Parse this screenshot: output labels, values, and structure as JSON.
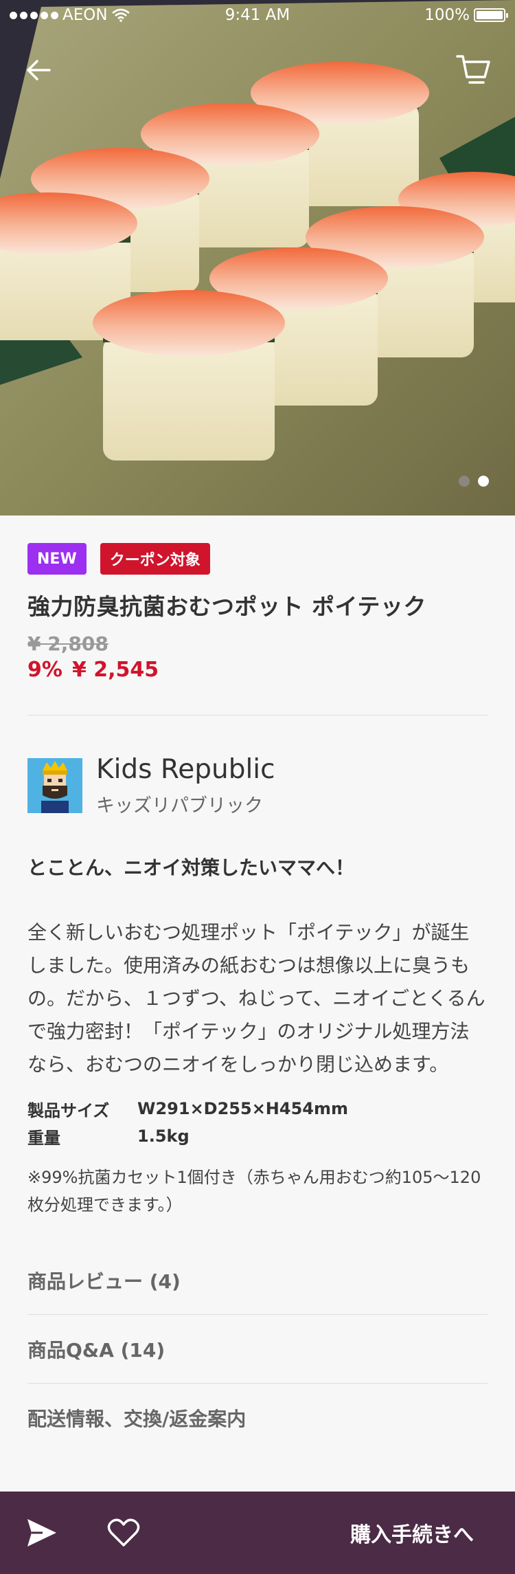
{
  "status_bar": {
    "carrier": "AEON",
    "time": "9:41 AM",
    "battery": "100%",
    "battery_level": 1.0,
    "signal_dots": 5
  },
  "hero": {
    "image_subject": "shrimp-sushi-photo",
    "page_count": 2,
    "active_page": 2,
    "colors": {
      "pager_active": "#ffffff",
      "pager_inactive": "#8a8780"
    }
  },
  "badges": {
    "new": "NEW",
    "coupon": "クーポン対象"
  },
  "product": {
    "title": "強力防臭抗菌おむつポット ポイテック",
    "original_price": "¥ 2,808",
    "discount": "9%",
    "sale_price": "¥ 2,545"
  },
  "brand": {
    "name": "Kids Republic",
    "kana": "キッズリパブリック",
    "logo": "king-character-logo"
  },
  "description": {
    "headline": "とことん、ニオイ対策したいママへ！",
    "body": "全く新しいおむつ処理ポット「ポイテック」が誕生しました。使用済みの紙おむつは想像以上に臭うもの。だから、１つずつ、ねじって、ニオイごとくるんで強力密封！「ポイテック」のオリジナル処理方法なら、おむつのニオイをしっかり閉じ込めます。",
    "specs": [
      {
        "label": "製品サイズ",
        "value": "W291×D255×H454mm"
      },
      {
        "label": "重量",
        "value": "1.5kg"
      }
    ],
    "note": "※99%抗菌カセット1個付き（赤ちゃん用おむつ約105〜120枚分処理できます。）"
  },
  "links": [
    {
      "label": "商品レビュー (4)"
    },
    {
      "label": "商品Q&A (14)"
    },
    {
      "label": "配送情報、交換/返金案内"
    }
  ],
  "bottom_bar": {
    "buy_label": "購入手続きへ",
    "colors": {
      "background": "#4b2b45"
    }
  },
  "icons": {
    "back": "arrow-left-icon",
    "cart": "cart-icon",
    "share": "send-icon",
    "favorite": "heart-icon"
  },
  "colors": {
    "accent_red": "#d0142c",
    "new_purple": "#9d2ff0"
  }
}
